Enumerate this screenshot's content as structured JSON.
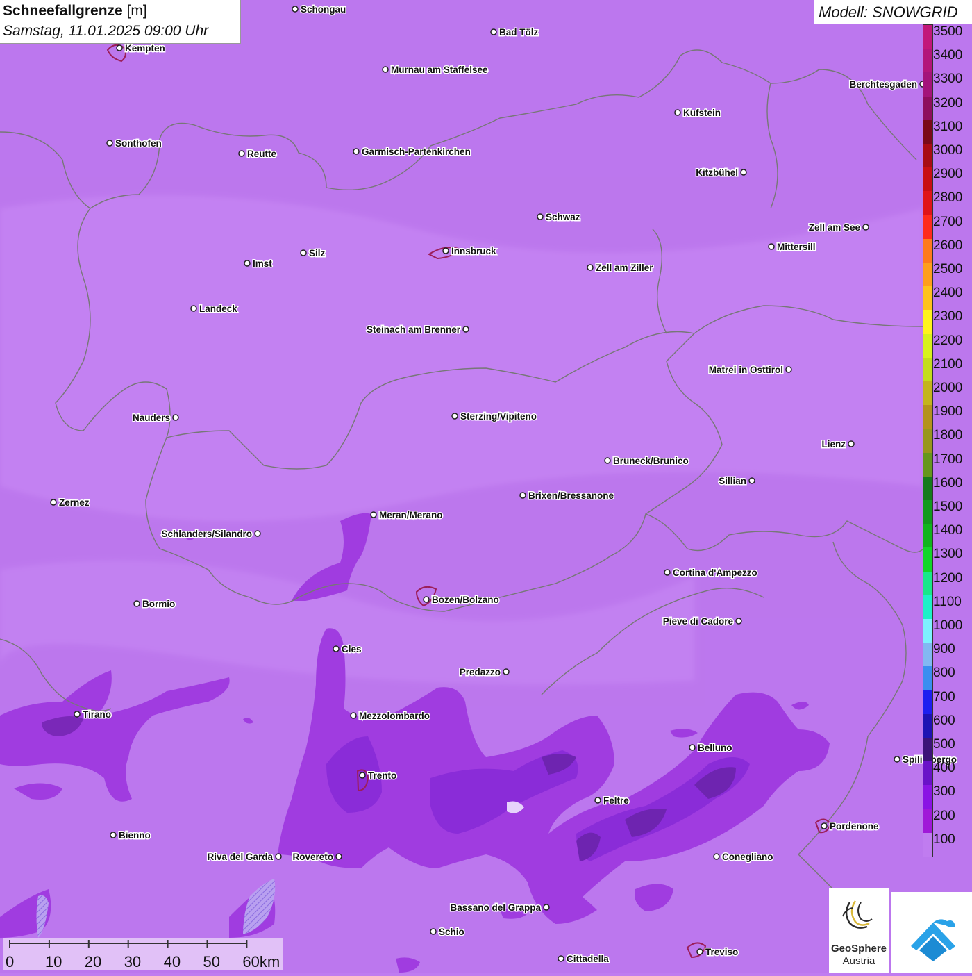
{
  "header": {
    "title": "Schneefallgrenze",
    "unit": "[m]",
    "datetime": "Samstag, 11.01.2025 09:00 Uhr",
    "model": "Modell: SNOWGRID"
  },
  "legend": {
    "levels": [
      {
        "label": "3500",
        "color": "#c2177a"
      },
      {
        "label": "3400",
        "color": "#b3157a"
      },
      {
        "label": "3300",
        "color": "#a4137a"
      },
      {
        "label": "3200",
        "color": "#8e0e5e"
      },
      {
        "label": "3100",
        "color": "#7a0a18"
      },
      {
        "label": "3000",
        "color": "#a80c14"
      },
      {
        "label": "2900",
        "color": "#c80e14"
      },
      {
        "label": "2800",
        "color": "#e0141a"
      },
      {
        "label": "2700",
        "color": "#ff2a1e"
      },
      {
        "label": "2600",
        "color": "#ff7a1e"
      },
      {
        "label": "2500",
        "color": "#ff9e1e"
      },
      {
        "label": "2400",
        "color": "#ffc21e"
      },
      {
        "label": "2300",
        "color": "#fff41e"
      },
      {
        "label": "2200",
        "color": "#d8f21e"
      },
      {
        "label": "2100",
        "color": "#c4dc1e"
      },
      {
        "label": "2000",
        "color": "#c4b41e"
      },
      {
        "label": "1900",
        "color": "#b4921e"
      },
      {
        "label": "1800",
        "color": "#98961e"
      },
      {
        "label": "1700",
        "color": "#66961e"
      },
      {
        "label": "1600",
        "color": "#167a1e"
      },
      {
        "label": "1500",
        "color": "#129a1e"
      },
      {
        "label": "1400",
        "color": "#10b41e"
      },
      {
        "label": "1300",
        "color": "#12d62a"
      },
      {
        "label": "1200",
        "color": "#18e88a"
      },
      {
        "label": "1100",
        "color": "#1ef2c8"
      },
      {
        "label": "1000",
        "color": "#7ef2ff"
      },
      {
        "label": "900",
        "color": "#82b8f2"
      },
      {
        "label": "800",
        "color": "#3a8ef0"
      },
      {
        "label": "700",
        "color": "#1e1ef0"
      },
      {
        "label": "600",
        "color": "#1e12b4"
      },
      {
        "label": "500",
        "color": "#3c1278"
      },
      {
        "label": "400",
        "color": "#6a12c8"
      },
      {
        "label": "300",
        "color": "#8a14e4"
      },
      {
        "label": "200",
        "color": "#a018d8"
      },
      {
        "label": "100",
        "color": "#c07cf0"
      }
    ]
  },
  "places": [
    {
      "name": "Schongau",
      "side": "right"
    },
    {
      "name": "Bad Tölz",
      "side": "right"
    },
    {
      "name": "Kempten",
      "side": "right"
    },
    {
      "name": "Murnau am Staffelsee",
      "side": "right"
    },
    {
      "name": "Berchtesgaden",
      "side": "left"
    },
    {
      "name": "Kufstein",
      "side": "right"
    },
    {
      "name": "Sonthofen",
      "side": "right"
    },
    {
      "name": "Reutte",
      "side": "right"
    },
    {
      "name": "Garmisch-Partenkirchen",
      "side": "right"
    },
    {
      "name": "Kitzbühel",
      "side": "left"
    },
    {
      "name": "Schwaz",
      "side": "right"
    },
    {
      "name": "Zell am See",
      "side": "left"
    },
    {
      "name": "Mittersill",
      "side": "right"
    },
    {
      "name": "Innsbruck",
      "side": "right"
    },
    {
      "name": "Silz",
      "side": "right"
    },
    {
      "name": "Imst",
      "side": "right"
    },
    {
      "name": "Zell am Ziller",
      "side": "right"
    },
    {
      "name": "Landeck",
      "side": "right"
    },
    {
      "name": "Steinach am Brenner",
      "side": "left"
    },
    {
      "name": "Matrei in Osttirol",
      "side": "left"
    },
    {
      "name": "Nauders",
      "side": "left"
    },
    {
      "name": "Sterzing/Vipiteno",
      "side": "right"
    },
    {
      "name": "Lienz",
      "side": "left"
    },
    {
      "name": "Bruneck/Brunico",
      "side": "right"
    },
    {
      "name": "Sillian",
      "side": "left"
    },
    {
      "name": "Zernez",
      "side": "right"
    },
    {
      "name": "Brixen/Bressanone",
      "side": "right"
    },
    {
      "name": "Meran/Merano",
      "side": "right"
    },
    {
      "name": "Schlanders/Silandro",
      "side": "left"
    },
    {
      "name": "Cortina d'Ampezzo",
      "side": "right"
    },
    {
      "name": "Bozen/Bolzano",
      "side": "right"
    },
    {
      "name": "Bormio",
      "side": "right"
    },
    {
      "name": "Pieve di Cadore",
      "side": "left"
    },
    {
      "name": "Cles",
      "side": "right"
    },
    {
      "name": "Predazzo",
      "side": "left"
    },
    {
      "name": "Tirano",
      "side": "right"
    },
    {
      "name": "Mezzolombardo",
      "side": "right"
    },
    {
      "name": "Belluno",
      "side": "right"
    },
    {
      "name": "Spilimbergo",
      "side": "right"
    },
    {
      "name": "Trento",
      "side": "right"
    },
    {
      "name": "Feltre",
      "side": "right"
    },
    {
      "name": "Pordenone",
      "side": "right"
    },
    {
      "name": "Bienno",
      "side": "right"
    },
    {
      "name": "Riva del Garda",
      "side": "left"
    },
    {
      "name": "Rovereto",
      "side": "left"
    },
    {
      "name": "Conegliano",
      "side": "right"
    },
    {
      "name": "Bassano del Grappa",
      "side": "left"
    },
    {
      "name": "Schio",
      "side": "right"
    },
    {
      "name": "Treviso",
      "side": "right"
    },
    {
      "name": "Cittadella",
      "side": "right"
    }
  ],
  "scalebar": {
    "labels": [
      "0",
      "10",
      "20",
      "30",
      "40",
      "50",
      "60km"
    ]
  },
  "logo": {
    "line1": "GeoSphere",
    "line2": "Austria"
  }
}
